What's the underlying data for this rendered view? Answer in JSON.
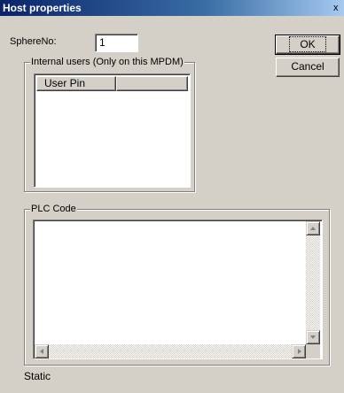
{
  "window": {
    "title": "Host properties",
    "close_glyph": "x"
  },
  "sphere": {
    "label": "SphereNo:",
    "value": "1"
  },
  "buttons": {
    "ok": "OK",
    "cancel": "Cancel"
  },
  "internal_users": {
    "caption": "Internal users (Only on this MPDM)",
    "columns": [
      "User Pin",
      ""
    ]
  },
  "plc": {
    "caption": "PLC Code",
    "value": ""
  },
  "status": {
    "text": "Static"
  },
  "icons": {
    "scroll_up": "arrow-up-icon",
    "scroll_down": "arrow-down-icon",
    "scroll_left": "arrow-left-icon",
    "scroll_right": "arrow-right-icon"
  },
  "colors": {
    "dialog_bg": "#d4d0c8",
    "title_start": "#0a246a",
    "title_end": "#a6caf0"
  }
}
